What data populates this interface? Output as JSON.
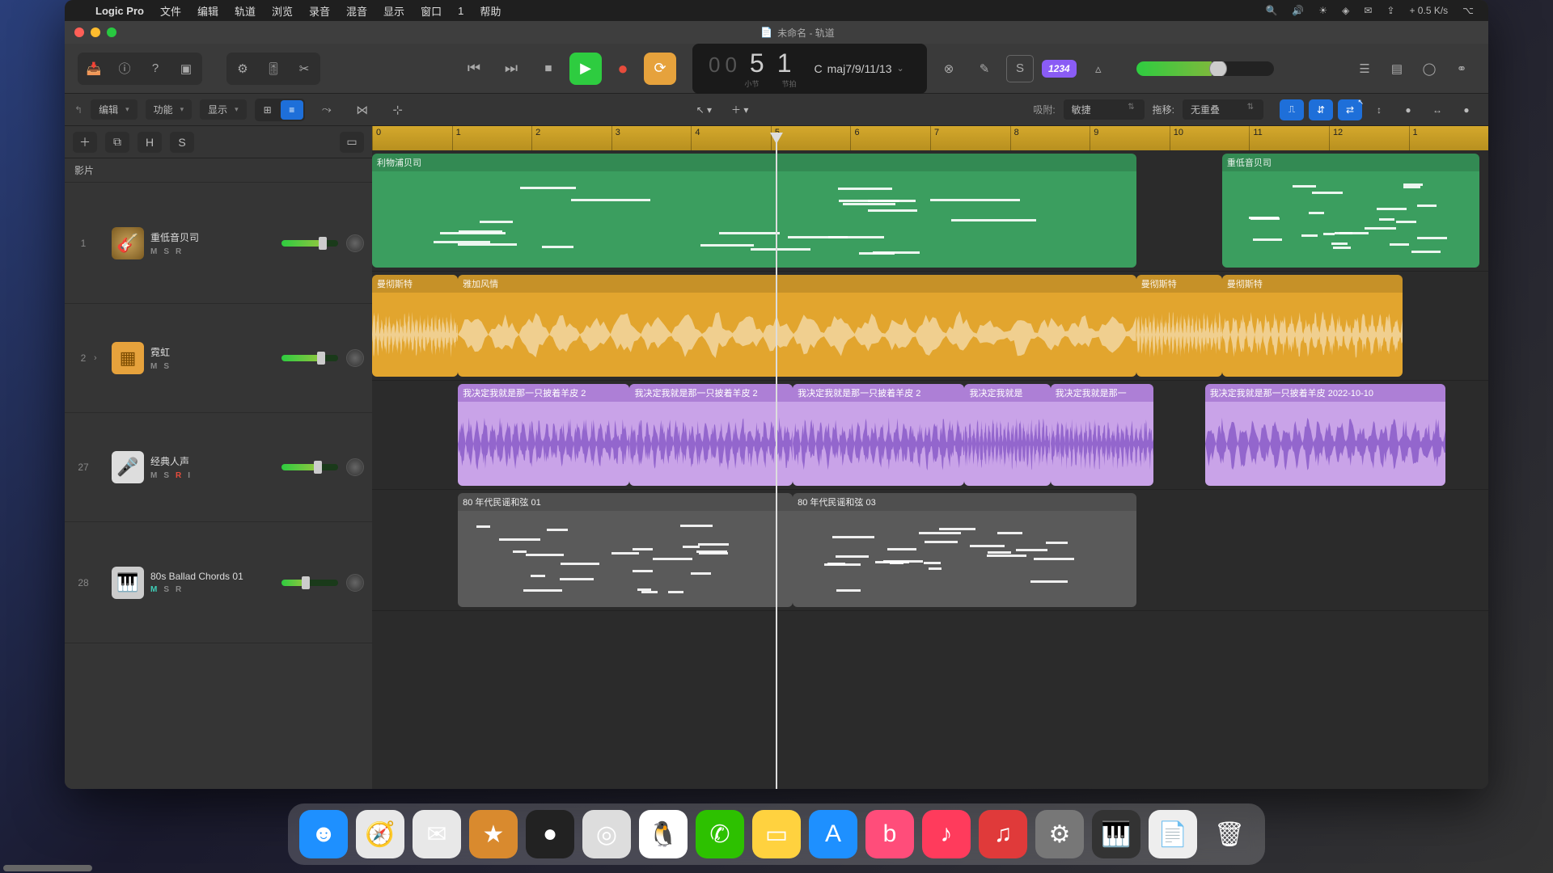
{
  "menubar": {
    "app": "Logic Pro",
    "items": [
      "文件",
      "编辑",
      "轨道",
      "浏览",
      "录音",
      "混音",
      "显示",
      "窗口",
      "1",
      "帮助"
    ],
    "status_net": "+ 0.5 K/s"
  },
  "window": {
    "title": "未命名 - 轨道"
  },
  "toolbar": {
    "lcd_dim": "00",
    "lcd_bars": "5",
    "lcd_beats": "1",
    "lcd_sub_left": "小节",
    "lcd_sub_right": "节拍",
    "key_root": "C",
    "key_chord": "maj7/9/11/13",
    "tempo_badge": "1234"
  },
  "subtoolbar": {
    "edit": "编辑",
    "func": "功能",
    "view": "显示",
    "snap_label": "吸附:",
    "snap_value": "敏捷",
    "drag_label": "拖移:",
    "drag_value": "无重叠"
  },
  "track_header": {
    "section": "影片",
    "btn_h": "H",
    "btn_s": "S"
  },
  "tracks": [
    {
      "num": "1",
      "name": "重低音贝司",
      "m": "M",
      "s": "S",
      "r": "R",
      "iconClass": "bass",
      "icon": "🎸",
      "fader": 70
    },
    {
      "num": "2",
      "name": "霓虹",
      "m": "M",
      "s": "S",
      "r": "",
      "iconClass": "synth",
      "icon": "▦",
      "fader": 68,
      "expand": "›"
    },
    {
      "num": "27",
      "name": "经典人声",
      "m": "M",
      "s": "S",
      "r": "R",
      "i": "I",
      "iconClass": "mic",
      "icon": "🎤",
      "fader": 62,
      "rec": true
    },
    {
      "num": "28",
      "name": "80s Ballad Chords 01",
      "m": "M",
      "s": "S",
      "r": "R",
      "iconClass": "piano",
      "icon": "🎹",
      "fader": 40,
      "mute": true
    }
  ],
  "ruler": {
    "start": 0,
    "bars": [
      "0",
      "1",
      "2",
      "3",
      "4",
      "5",
      "6",
      "7",
      "8",
      "9",
      "10",
      "11",
      "12",
      "1"
    ]
  },
  "regions": {
    "track1": [
      {
        "label": "利物浦贝司",
        "start": 0.3,
        "end": 9.2,
        "notes": true
      },
      {
        "label": "重低音贝司",
        "start": 10.2,
        "end": 13.2,
        "notes": true
      }
    ],
    "track2": [
      {
        "label": "曼彻斯特",
        "start": 0.3,
        "end": 1.3
      },
      {
        "label": "雅加风情",
        "start": 1.3,
        "end": 9.2
      },
      {
        "label": "曼彻斯特",
        "start": 9.2,
        "end": 10.2
      },
      {
        "label": "曼彻斯特",
        "start": 10.2,
        "end": 12.3
      }
    ],
    "track3": [
      {
        "label": "我决定我就是那一只披着羊皮 2",
        "start": 1.3,
        "end": 3.3
      },
      {
        "label": "我决定我就是那一只披着羊皮 2",
        "start": 3.3,
        "end": 5.2
      },
      {
        "label": "我决定我就是那一只披着羊皮 2",
        "start": 5.2,
        "end": 7.2
      },
      {
        "label": "我决定我就是",
        "start": 7.2,
        "end": 8.2
      },
      {
        "label": "我决定我就是那一",
        "start": 8.2,
        "end": 9.4
      },
      {
        "label": "我决定我就是那一只披着羊皮 2022-10-10",
        "start": 10.0,
        "end": 12.8
      }
    ],
    "track4": [
      {
        "label": "80 年代民谣和弦 01",
        "start": 1.3,
        "end": 5.2
      },
      {
        "label": "80 年代民谣和弦 03",
        "start": 5.2,
        "end": 9.2
      }
    ]
  },
  "dock": [
    {
      "name": "finder",
      "bg": "#1e90ff",
      "icon": "☻"
    },
    {
      "name": "safari",
      "bg": "#e8e8e8",
      "icon": "🧭"
    },
    {
      "name": "mail",
      "bg": "#e8e8e8",
      "icon": "✉"
    },
    {
      "name": "logic",
      "bg": "#d98a2e",
      "icon": "★"
    },
    {
      "name": "apogee",
      "bg": "#222",
      "icon": "●"
    },
    {
      "name": "disc",
      "bg": "#ddd",
      "icon": "◎"
    },
    {
      "name": "qq",
      "bg": "#fff",
      "icon": "🐧"
    },
    {
      "name": "wechat",
      "bg": "#2dc100",
      "icon": "✆"
    },
    {
      "name": "notes",
      "bg": "#ffd23f",
      "icon": "▭"
    },
    {
      "name": "appstore",
      "bg": "#1e90ff",
      "icon": "A"
    },
    {
      "name": "bilibili",
      "bg": "#ff4d7a",
      "icon": "b"
    },
    {
      "name": "music",
      "bg": "#ff3b5c",
      "icon": "♪"
    },
    {
      "name": "netease",
      "bg": "#e03a3a",
      "icon": "♫"
    },
    {
      "name": "settings",
      "bg": "#777",
      "icon": "⚙"
    },
    {
      "name": "midi",
      "bg": "#333",
      "icon": "🎹"
    },
    {
      "name": "document",
      "bg": "#eee",
      "icon": "📄"
    },
    {
      "name": "trash",
      "bg": "transparent",
      "icon": "🗑"
    }
  ]
}
